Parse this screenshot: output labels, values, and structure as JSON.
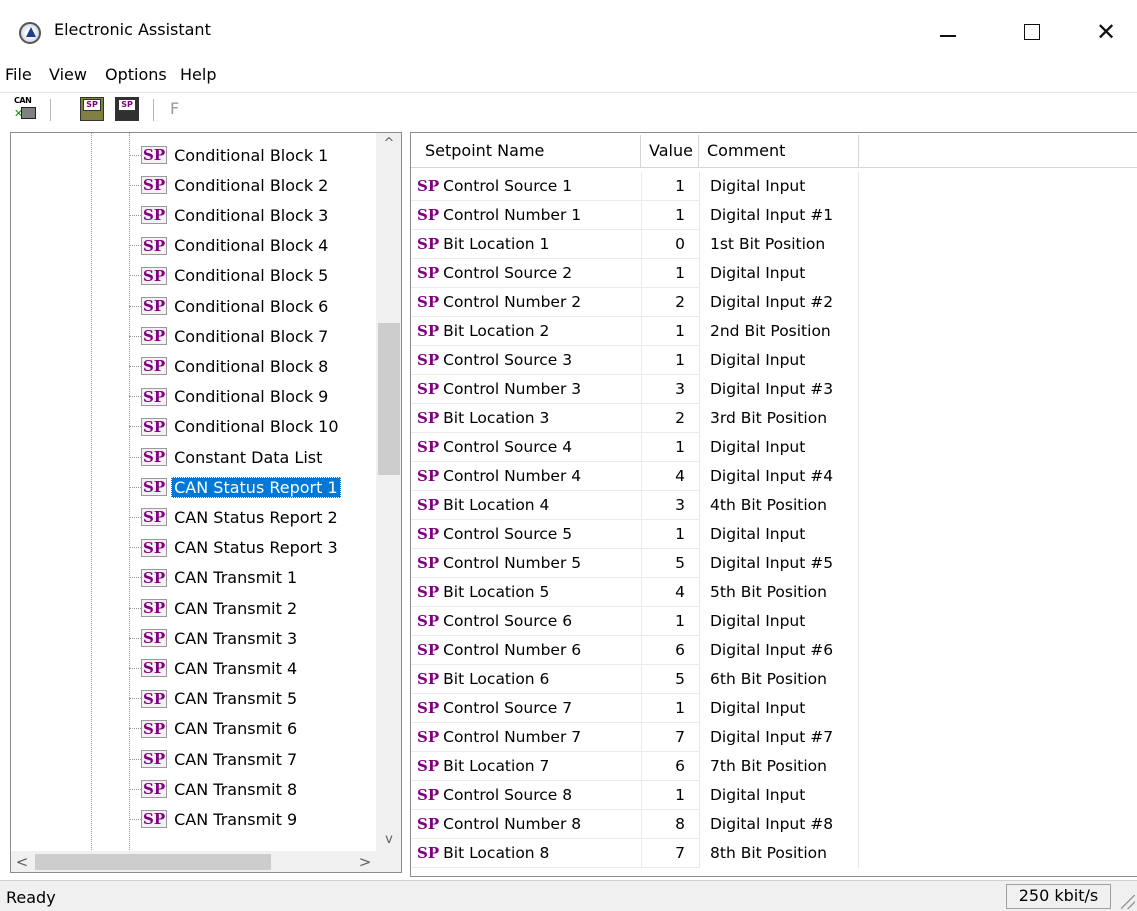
{
  "window": {
    "title": "Electronic Assistant",
    "close_glyph": "✕"
  },
  "menu": [
    "File",
    "View",
    "Options",
    "Help"
  ],
  "toolbar": {
    "can_icon_text": "CAN",
    "sp_icon_text": "SP",
    "f_label": "F"
  },
  "tree": {
    "badge": "SP",
    "items": [
      "Conditional Block 1",
      "Conditional Block 2",
      "Conditional Block 3",
      "Conditional Block 4",
      "Conditional Block 5",
      "Conditional Block 6",
      "Conditional Block 7",
      "Conditional Block 8",
      "Conditional Block 9",
      "Conditional Block 10",
      "Constant Data List",
      "CAN Status Report 1",
      "CAN Status Report 2",
      "CAN Status Report 3",
      "CAN Transmit 1",
      "CAN Transmit 2",
      "CAN Transmit 3",
      "CAN Transmit 4",
      "CAN Transmit 5",
      "CAN Transmit 6",
      "CAN Transmit 7",
      "CAN Transmit 8",
      "CAN Transmit 9"
    ],
    "selected": "CAN Status Report 1",
    "scroll_up_glyph": "^",
    "scroll_down_glyph": "v",
    "scroll_left_glyph": "<",
    "scroll_right_glyph": ">"
  },
  "grid": {
    "headers": {
      "name": "Setpoint Name",
      "value": "Value",
      "comment": "Comment"
    },
    "badge": "SP",
    "rows": [
      {
        "name": "Control Source 1",
        "value": "1",
        "comment": "Digital Input"
      },
      {
        "name": "Control Number 1",
        "value": "1",
        "comment": "Digital Input #1"
      },
      {
        "name": "Bit Location 1",
        "value": "0",
        "comment": "1st Bit Position"
      },
      {
        "name": "Control Source 2",
        "value": "1",
        "comment": "Digital Input"
      },
      {
        "name": "Control Number 2",
        "value": "2",
        "comment": "Digital Input #2"
      },
      {
        "name": "Bit Location 2",
        "value": "1",
        "comment": "2nd Bit Position"
      },
      {
        "name": "Control Source 3",
        "value": "1",
        "comment": "Digital Input"
      },
      {
        "name": "Control Number 3",
        "value": "3",
        "comment": "Digital Input #3"
      },
      {
        "name": "Bit Location 3",
        "value": "2",
        "comment": "3rd Bit Position"
      },
      {
        "name": "Control Source 4",
        "value": "1",
        "comment": "Digital Input"
      },
      {
        "name": "Control Number 4",
        "value": "4",
        "comment": "Digital Input #4"
      },
      {
        "name": "Bit Location 4",
        "value": "3",
        "comment": "4th Bit Position"
      },
      {
        "name": "Control Source 5",
        "value": "1",
        "comment": "Digital Input"
      },
      {
        "name": "Control Number 5",
        "value": "5",
        "comment": "Digital Input #5"
      },
      {
        "name": "Bit Location 5",
        "value": "4",
        "comment": "5th Bit Position"
      },
      {
        "name": "Control Source 6",
        "value": "1",
        "comment": "Digital Input"
      },
      {
        "name": "Control Number 6",
        "value": "6",
        "comment": "Digital Input #6"
      },
      {
        "name": "Bit Location 6",
        "value": "5",
        "comment": "6th Bit Position"
      },
      {
        "name": "Control Source 7",
        "value": "1",
        "comment": "Digital Input"
      },
      {
        "name": "Control Number 7",
        "value": "7",
        "comment": "Digital Input #7"
      },
      {
        "name": "Bit Location 7",
        "value": "6",
        "comment": "7th Bit Position"
      },
      {
        "name": "Control Source 8",
        "value": "1",
        "comment": "Digital Input"
      },
      {
        "name": "Control Number 8",
        "value": "8",
        "comment": "Digital Input #8"
      },
      {
        "name": "Bit Location 8",
        "value": "7",
        "comment": "8th Bit Position"
      }
    ]
  },
  "status": {
    "text": "Ready",
    "baud": "250 kbit/s"
  },
  "colors": {
    "selection": "#0078d7",
    "sp_badge": "#800080"
  }
}
